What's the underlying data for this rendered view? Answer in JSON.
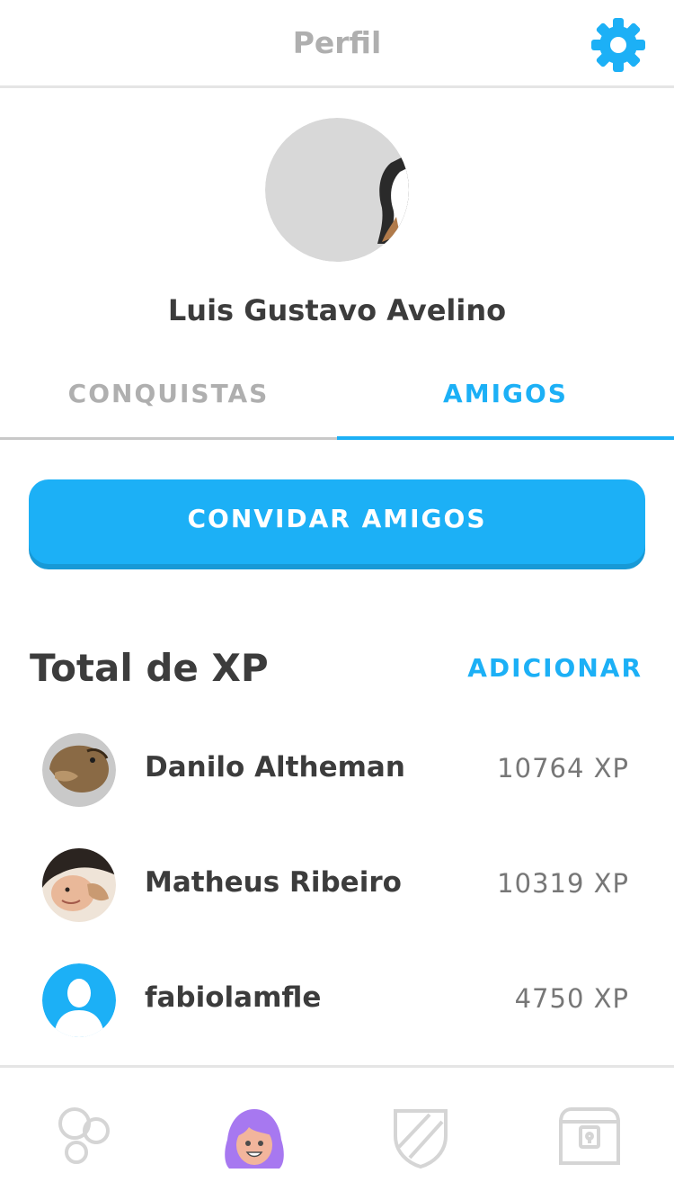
{
  "header": {
    "title": "Perfil",
    "settings_icon": "gear-icon"
  },
  "profile": {
    "name": "Luis Gustavo Avelino"
  },
  "tabs": [
    {
      "label": "CONQUISTAS",
      "active": false
    },
    {
      "label": "AMIGOS",
      "active": true
    }
  ],
  "invite_button": {
    "label": "CONVIDAR AMIGOS"
  },
  "leaderboard": {
    "title": "Total de XP",
    "add_label": "ADICIONAR",
    "friends": [
      {
        "name": "Danilo Altheman",
        "xp": "10764 XP"
      },
      {
        "name": "Matheus Ribeiro",
        "xp": "10319 XP"
      },
      {
        "name": "fabiolamfle",
        "xp": "4750 XP"
      }
    ]
  },
  "bottom_nav": [
    {
      "icon": "bubbles-icon",
      "active": false
    },
    {
      "icon": "profile-character-icon",
      "active": true
    },
    {
      "icon": "shield-icon",
      "active": false
    },
    {
      "icon": "shop-chest-icon",
      "active": false
    }
  ],
  "colors": {
    "accent": "#1cb0f6",
    "muted": "#afafaf",
    "text": "#3c3c3c",
    "avatar_purple": "#a778f0"
  }
}
